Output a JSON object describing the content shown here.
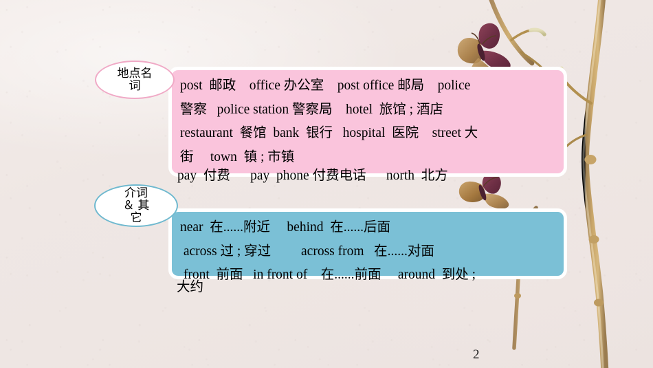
{
  "slide": {
    "page_number": "2",
    "background_color": "#f0e9e7"
  },
  "colors": {
    "pink_box": "#fac4dc",
    "pink_oval_border": "#f0a9c6",
    "blue_box": "#7bc0d6",
    "blue_oval_border": "#6fb9cf",
    "box_outline": "#ffffff",
    "text": "#000000"
  },
  "sections": [
    {
      "label": "地点名\n词",
      "label_plain": "地点名词",
      "box_lines": [
        "post  邮政    office 办公室    post office 邮局    police",
        "警察   police station 警察局    hotel  旅馆 ; 酒店",
        "restaurant  餐馆  bank  银行   hospital  医院    street 大",
        "街     town  镇 ; 市镇"
      ],
      "overflow_line": "pay  付费      pay  phone 付费电话      north  北方",
      "entries": [
        {
          "en": "post",
          "zh": "邮政"
        },
        {
          "en": "office",
          "zh": "办公室"
        },
        {
          "en": "post office",
          "zh": "邮局"
        },
        {
          "en": "police",
          "zh": "警察"
        },
        {
          "en": "police station",
          "zh": "警察局"
        },
        {
          "en": "hotel",
          "zh": "旅馆 ; 酒店"
        },
        {
          "en": "restaurant",
          "zh": "餐馆"
        },
        {
          "en": "bank",
          "zh": "银行"
        },
        {
          "en": "hospital",
          "zh": "医院"
        },
        {
          "en": "street",
          "zh": "大街"
        },
        {
          "en": "town",
          "zh": "镇 ; 市镇"
        },
        {
          "en": "pay",
          "zh": "付费"
        },
        {
          "en": "pay phone",
          "zh": "付费电话"
        },
        {
          "en": "north",
          "zh": "北方"
        }
      ]
    },
    {
      "label": "介词\n＆ 其\n它",
      "label_plain": "介词 ＆ 其它",
      "box_lines": [
        "near  在......附近     behind  在......后面",
        " across 过 ; 穿过         across from   在......对面",
        " front  前面   in front of    在......前面     around  到处 ;"
      ],
      "overflow_line": "大约",
      "entries": [
        {
          "en": "near",
          "zh": "在......附近"
        },
        {
          "en": "behind",
          "zh": "在......后面"
        },
        {
          "en": "across",
          "zh": "过 ; 穿过"
        },
        {
          "en": "across from",
          "zh": "在......对面"
        },
        {
          "en": "front",
          "zh": "前面"
        },
        {
          "en": "in front of",
          "zh": "在......前面"
        },
        {
          "en": "around",
          "zh": "到处 ; 大约"
        }
      ]
    }
  ],
  "decorations": [
    {
      "name": "dried-branch-tall",
      "description": "tall dried twig on right edge"
    },
    {
      "name": "dried-branch-short",
      "description": "short dried twig lower middle-right"
    },
    {
      "name": "pressed-butterfly-upper",
      "description": "dried pressed butterfly near top branch"
    },
    {
      "name": "pressed-butterfly-lower",
      "description": "dried pressed butterfly mid-right"
    }
  ]
}
